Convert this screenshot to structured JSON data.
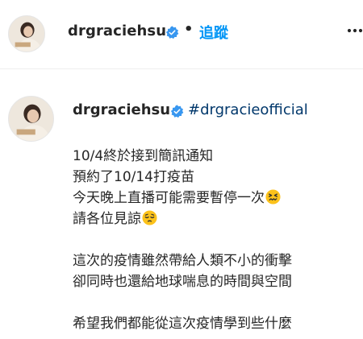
{
  "header": {
    "username": "drgraciehsu",
    "separator": "•",
    "follow_label": "追蹤",
    "more_icon": "more-horizontal-icon",
    "verified_icon": "verified-badge-icon"
  },
  "caption": {
    "username": "drgraciehsu",
    "hashtag": "#drgracieofficial",
    "lines": [
      "10/4終於接到簡訊通知",
      "預約了10/14打疫苗",
      "今天晚上直播可能需要暫停一次",
      "請各位見諒",
      "",
      "這次的疫情雖然帶給人類不小的衝擊",
      "卻同時也還給地球喘息的時間與空間",
      "",
      "希望我們都能從這次疫情學到些什麼"
    ],
    "emoji_line3": "confounded-face-emoji",
    "emoji_line4": "pensive-face-emoji"
  },
  "colors": {
    "accent": "#0095f6",
    "hashtag": "#00376b",
    "text": "#262626",
    "verified": "#3897f0"
  }
}
